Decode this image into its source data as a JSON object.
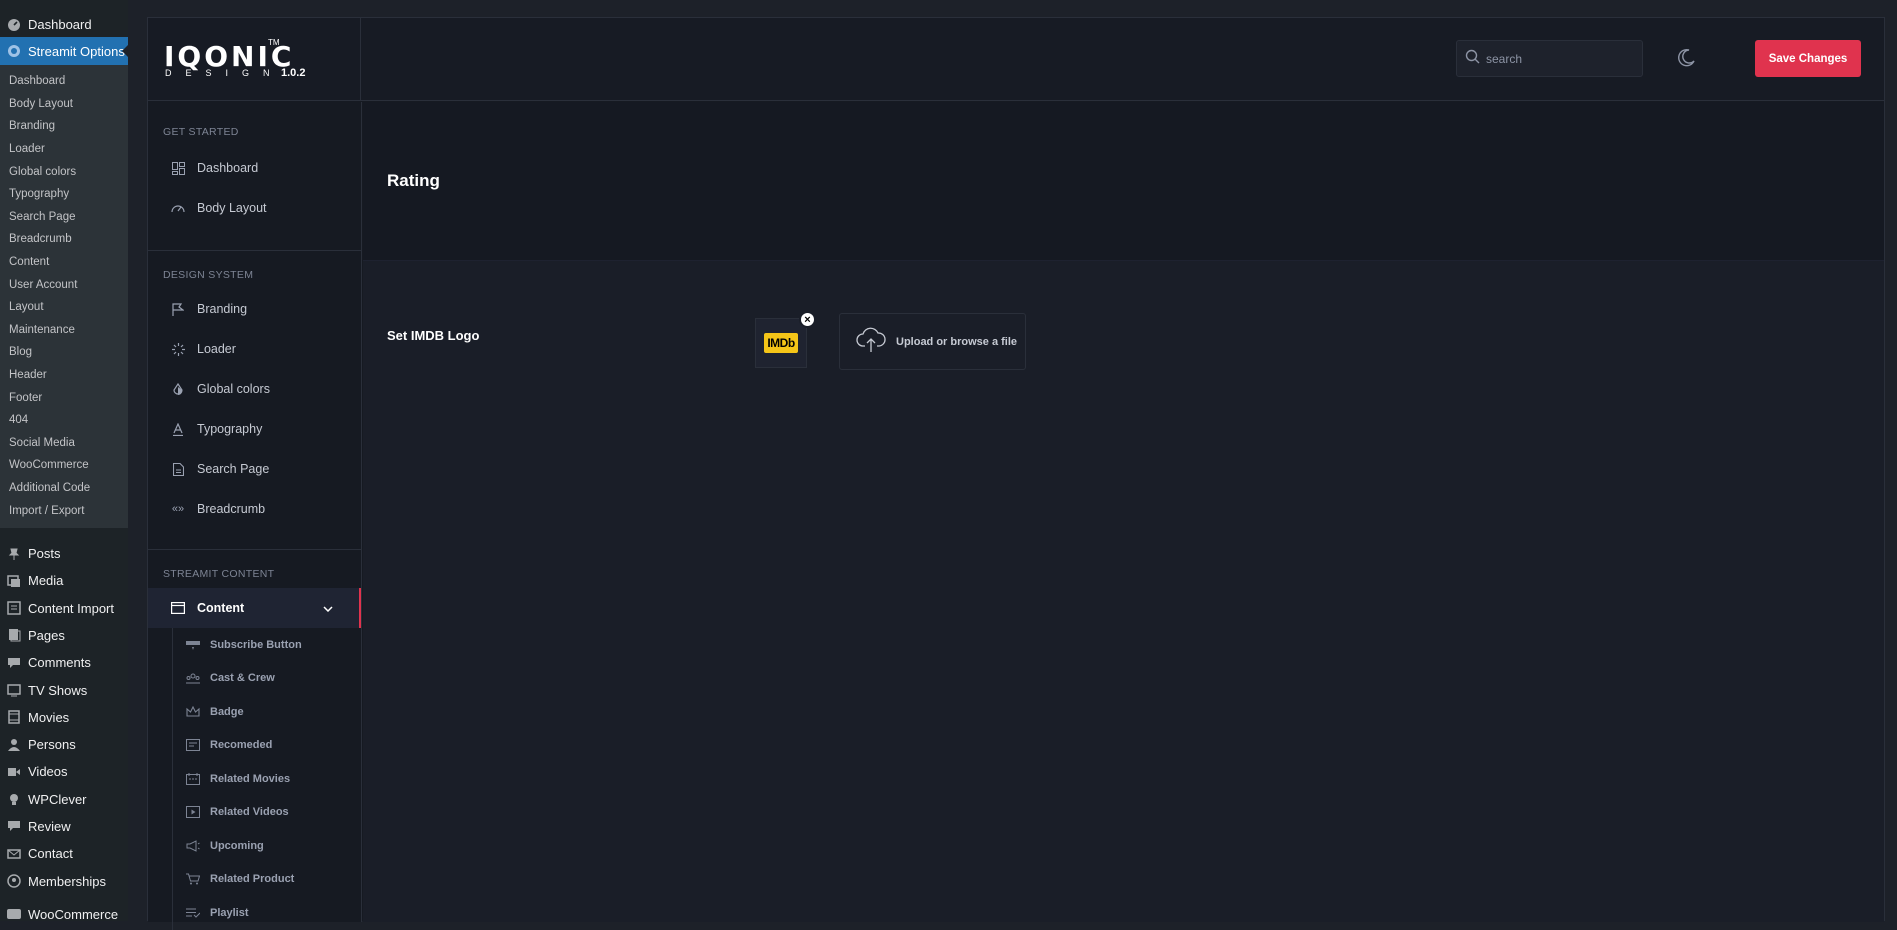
{
  "wp_menu": {
    "dashboard": "Dashboard",
    "streamit_options": "Streamit Options",
    "submenu": [
      "Dashboard",
      "Body Layout",
      "Branding",
      "Loader",
      "Global colors",
      "Typography",
      "Search Page",
      "Breadcrumb",
      "Content",
      "User Account",
      "Layout",
      "Maintenance",
      "Blog",
      "Header",
      "Footer",
      "404",
      "Social Media",
      "WooCommerce",
      "Additional Code",
      "Import / Export"
    ],
    "bottom": [
      {
        "label": "Posts",
        "icon": "pin-icon"
      },
      {
        "label": "Media",
        "icon": "media-icon"
      },
      {
        "label": "Content Import",
        "icon": "import-icon"
      },
      {
        "label": "Pages",
        "icon": "pages-icon"
      },
      {
        "label": "Comments",
        "icon": "comments-icon"
      },
      {
        "label": "TV Shows",
        "icon": "tv-icon"
      },
      {
        "label": "Movies",
        "icon": "film-icon"
      },
      {
        "label": "Persons",
        "icon": "person-icon"
      },
      {
        "label": "Videos",
        "icon": "video-icon"
      },
      {
        "label": "WPClever",
        "icon": "bulb-icon"
      },
      {
        "label": "Review",
        "icon": "review-icon"
      },
      {
        "label": "Contact",
        "icon": "mail-icon"
      },
      {
        "label": "Memberships",
        "icon": "members-icon"
      },
      {
        "label": "WooCommerce",
        "icon": "woo-icon"
      }
    ]
  },
  "header": {
    "logo": "IQONIC",
    "logo_tm": "TM",
    "logo_sub": "DESIGN",
    "version": "1.0.2",
    "search_placeholder": "search",
    "save_label": "Save Changes"
  },
  "nav": {
    "groups": [
      {
        "title": "GET STARTED",
        "items": [
          {
            "label": "Dashboard",
            "icon": "grid-icon"
          },
          {
            "label": "Body Layout",
            "icon": "gauge-icon"
          }
        ]
      },
      {
        "title": "DESIGN SYSTEM",
        "items": [
          {
            "label": "Branding",
            "icon": "flag-icon"
          },
          {
            "label": "Loader",
            "icon": "loader-icon"
          },
          {
            "label": "Global colors",
            "icon": "drop-icon"
          },
          {
            "label": "Typography",
            "icon": "type-icon"
          },
          {
            "label": "Search Page",
            "icon": "doc-icon"
          },
          {
            "label": "Breadcrumb",
            "icon": "breadcrumb-icon"
          }
        ]
      },
      {
        "title": "STREAMIT CONTENT",
        "items": [
          {
            "label": "Content",
            "icon": "window-icon"
          }
        ]
      }
    ],
    "content_sub": [
      "Subscribe Button",
      "Cast & Crew",
      "Badge",
      "Recomeded",
      "Related Movies",
      "Related Videos",
      "Upcoming",
      "Related Product",
      "Playlist"
    ]
  },
  "main": {
    "title": "Rating",
    "field_label": "Set IMDB Logo",
    "logo_badge": "IMDb",
    "upload_label": "Upload or browse a file"
  },
  "colors": {
    "accent": "#e0334e",
    "wp_active": "#2271b1",
    "imdb": "#f5c518"
  }
}
